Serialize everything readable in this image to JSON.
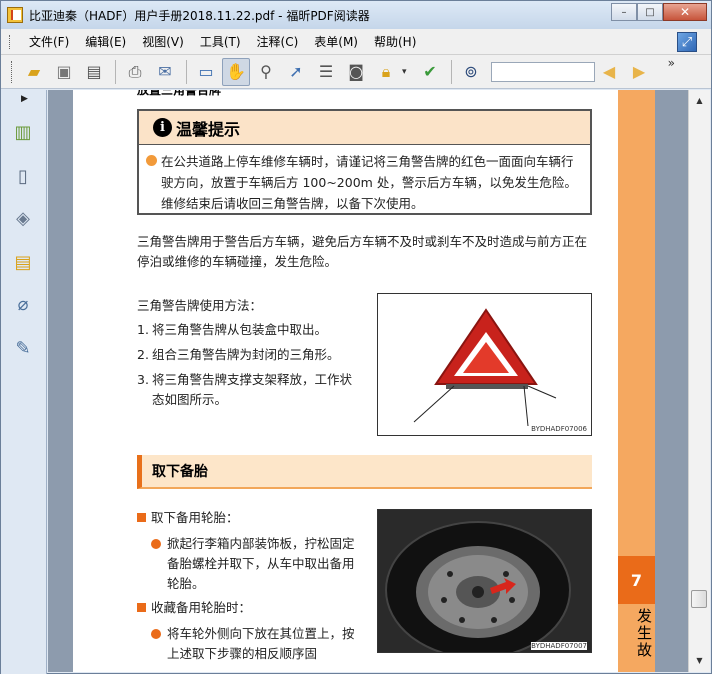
{
  "window": {
    "title": "比亚迪秦（HADF）用户手册2018.11.22.pdf - 福昕PDF阅读器",
    "buttons": {
      "minimize": "–",
      "maximize": "□",
      "close": "✕"
    }
  },
  "menubar": {
    "items": [
      {
        "label": "文件(F)"
      },
      {
        "label": "编辑(E)"
      },
      {
        "label": "视图(V)"
      },
      {
        "label": "工具(T)"
      },
      {
        "label": "注释(C)"
      },
      {
        "label": "表单(M)"
      },
      {
        "label": "帮助(H)"
      }
    ]
  },
  "toolbar": {
    "more": "»",
    "search_value": ""
  },
  "page": {
    "top_heading": "放置三角警告牌",
    "notice": {
      "title": "温馨提示",
      "text": "在公共道路上停车维修车辆时，请谨记将三角警告牌的红色一面面向车辆行驶方向，放置于车辆后方 100~200m 处，警示后方车辆，以免发生危险。维修结束后请收回三角警告牌，以备下次使用。"
    },
    "paragraph": "三角警告牌用于警告后方车辆，避免后方车辆不及时或刹车不及时造成与前方正在停泊或维修的车辆碰撞，发生危险。",
    "usage_title": "三角警告牌使用方法：",
    "steps": [
      {
        "num": "1.",
        "text": "将三角警告牌从包装盒中取出。"
      },
      {
        "num": "2.",
        "text": "组合三角警告牌为封闭的三角形。"
      },
      {
        "num": "3.",
        "text": "将三角警告牌支撑支架释放，工作状态如图所示。"
      }
    ],
    "figure1_label": "BYDHADF07006",
    "section_title": "取下备胎",
    "sub1_title": "取下备用轮胎：",
    "sub1_bullet": "掀起行李箱内部装饰板，拧松固定备胎螺栓并取下，从车中取出备用轮胎。",
    "sub2_title": "收藏备用轮胎时：",
    "sub2_bullet": "将车轮外侧向下放在其位置上，按上述取下步骤的相反顺序固",
    "figure2_label": "BYDHADF07007",
    "side_number": "7",
    "side_text": "发生故"
  },
  "colors": {
    "accent_orange": "#ea6b19",
    "strip_orange": "#f5a860",
    "notice_header": "#fbe3c8"
  }
}
